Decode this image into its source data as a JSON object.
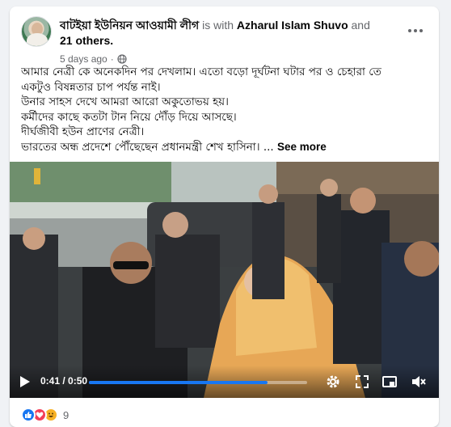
{
  "post": {
    "author": "বাটইয়া ইউনিয়ন আওয়ামী লীগ",
    "with_text": "is with",
    "tagged": "Azharul Islam Shuvo",
    "and_text": "and",
    "others": "21 others.",
    "time": "5 days ago",
    "time_sep": "·",
    "text_lines": [
      "আমার নেত্রী কে অনেকদিন পর দেখলাম। এতো বড়ো দূর্ঘটনা ঘটার পর ও চেহারা তে",
      "একটুও বিষন্নতার চাপ পর্যন্ত নাই।",
      "উনার সাহস দেখে আমরা আরো অকুতোভয় হয়।",
      "কর্মীদের কাছে কতটা টান নিয়ে দৌঁড় দিয়ে আসছে।",
      "দীর্ঘজীবী হউন প্রাণের নেত্রী।",
      "ভারতের অন্ধ প্রদেশে পৌঁছেছেন প্রধানমন্ত্রী শেখ হাসিনা। ..."
    ],
    "see_more": "See more"
  },
  "video": {
    "time_label": "0:41 / 0:50",
    "progress": 0.82
  },
  "footer": {
    "reaction_count": "9"
  },
  "colors": {
    "accent": "#1877f2",
    "secondary_text": "#65676b"
  }
}
